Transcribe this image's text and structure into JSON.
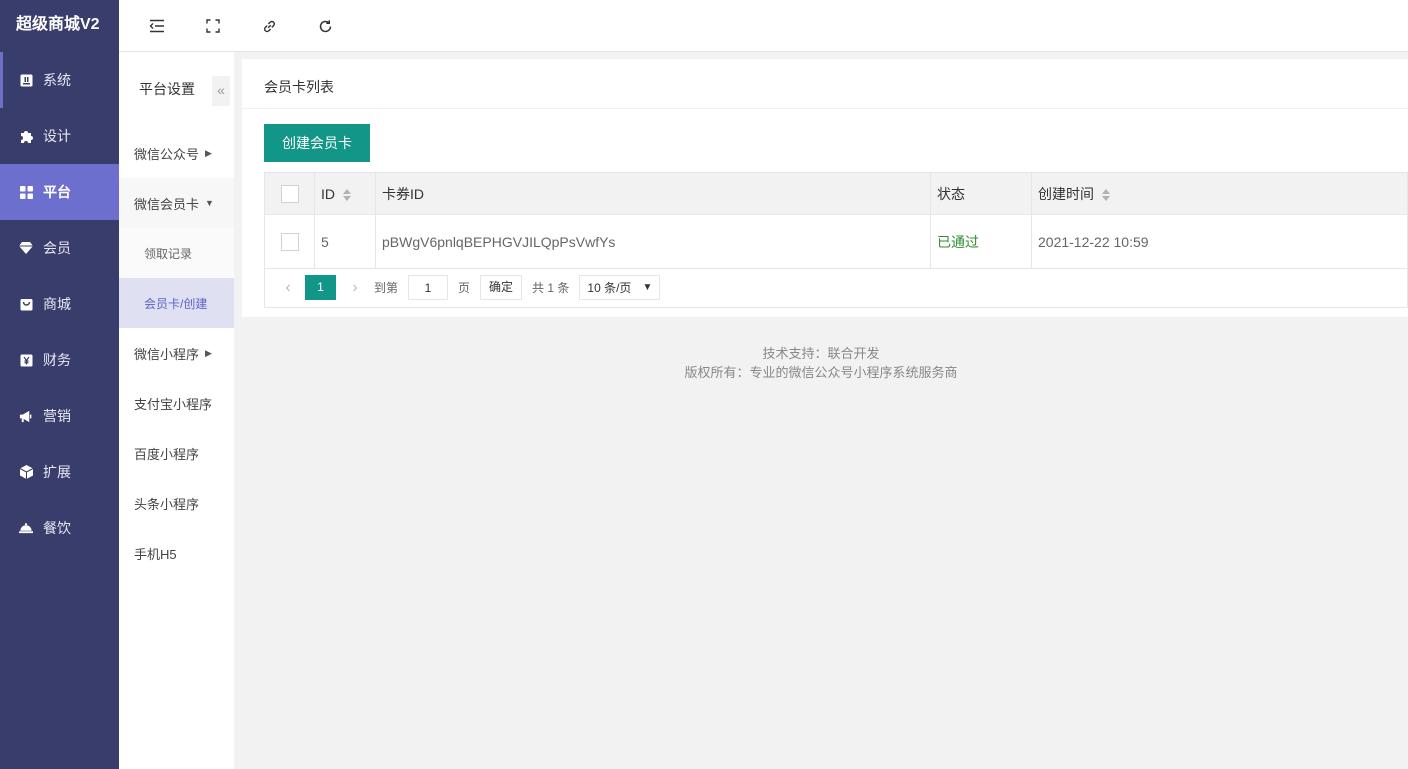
{
  "app": {
    "title": "超级商城V2"
  },
  "sidebar": {
    "items": [
      {
        "label": "系统",
        "icon": "system-icon"
      },
      {
        "label": "设计",
        "icon": "puzzle-icon"
      },
      {
        "label": "平台",
        "icon": "grid-icon"
      },
      {
        "label": "会员",
        "icon": "diamond-icon"
      },
      {
        "label": "商城",
        "icon": "shop-icon"
      },
      {
        "label": "财务",
        "icon": "yen-icon"
      },
      {
        "label": "营销",
        "icon": "megaphone-icon"
      },
      {
        "label": "扩展",
        "icon": "cube-icon"
      },
      {
        "label": "餐饮",
        "icon": "dish-icon"
      }
    ],
    "active": "平台"
  },
  "submenu": {
    "title": "平台设置",
    "collapse_glyph": "«",
    "items": [
      {
        "label": "微信公众号"
      },
      {
        "label": "微信会员卡"
      },
      {
        "label": "领取记录"
      },
      {
        "label": "会员卡/创建"
      },
      {
        "label": "微信小程序"
      },
      {
        "label": "支付宝小程序"
      },
      {
        "label": "百度小程序"
      },
      {
        "label": "头条小程序"
      },
      {
        "label": "手机H5"
      }
    ]
  },
  "page": {
    "card_title": "会员卡列表",
    "create_button": "创建会员卡"
  },
  "table": {
    "headers": {
      "id": "ID",
      "card_id": "卡券ID",
      "status": "状态",
      "created": "创建时间"
    },
    "rows": [
      {
        "id": "5",
        "card_id": "pBWgV6pnlqBEPHGVJILQpPsVwfYs",
        "status": "已通过",
        "created": "2021-12-22 10:59"
      }
    ]
  },
  "pagination": {
    "current_page": "1",
    "goto_prefix": "到第",
    "goto_value": "1",
    "goto_suffix": "页",
    "confirm": "确定",
    "total": "共 1 条",
    "page_size": "10 条/页"
  },
  "footer": {
    "line1": "技术支持：联合开发",
    "line2": "版权所有：专业的微信公众号小程序系统服务商"
  },
  "colors": {
    "sidebar_bg": "#393d6b",
    "active_nav": "#6c6fcd",
    "primary": "#119688",
    "status_ok": "#2f8f2f"
  }
}
